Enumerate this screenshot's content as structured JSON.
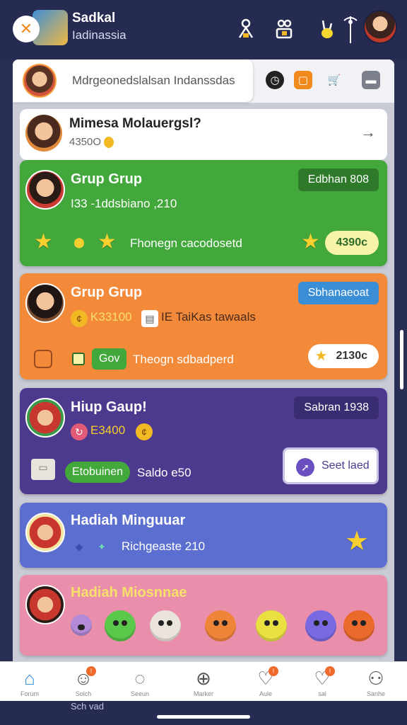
{
  "header": {
    "title": "Sadkal",
    "subtitle": "Iadinassia",
    "close_icon": "close-icon"
  },
  "search": {
    "text": "Mdrgeonedslalsan Indanssdas"
  },
  "profile": {
    "name": "Mimesa Molauergsl?",
    "points": "4350O"
  },
  "groups": [
    {
      "title": "Grup Grup",
      "tag": "Edbhan 808",
      "subline": "I33 -1ddsbiano ,210",
      "footer_text": "Fhonegn cacodosetd",
      "pill": "4390c",
      "color": "#43a83c"
    },
    {
      "title": "Grup Grup",
      "tag": "Sbhanaeoat",
      "subline_left": "K33100",
      "subline_right": "IE TaiKas tawaals",
      "footer_badge": "Gov",
      "footer_text": "Theogn sdbadperd",
      "pill": "2130c",
      "color": "#f38a3a"
    },
    {
      "title": "Hiup Gaup!",
      "tag": "Sabran 1938",
      "subline": "E3400",
      "footer_badge": "Etobuinen",
      "footer_text": "Saldo e50",
      "button_label": "Seet laed",
      "color": "#4d3a8f"
    },
    {
      "title": "Hadiah Minguuar",
      "subline": "Richgeaste 210",
      "color": "#5c6fd0"
    },
    {
      "title": "Hadiah Miosnnae",
      "color": "#e98fac"
    }
  ],
  "nav": {
    "items": [
      "Forum",
      "Solch",
      "Seeun",
      "Marker",
      "Aule",
      "sal",
      "Sanhe"
    ],
    "caption": "Sch vad"
  }
}
